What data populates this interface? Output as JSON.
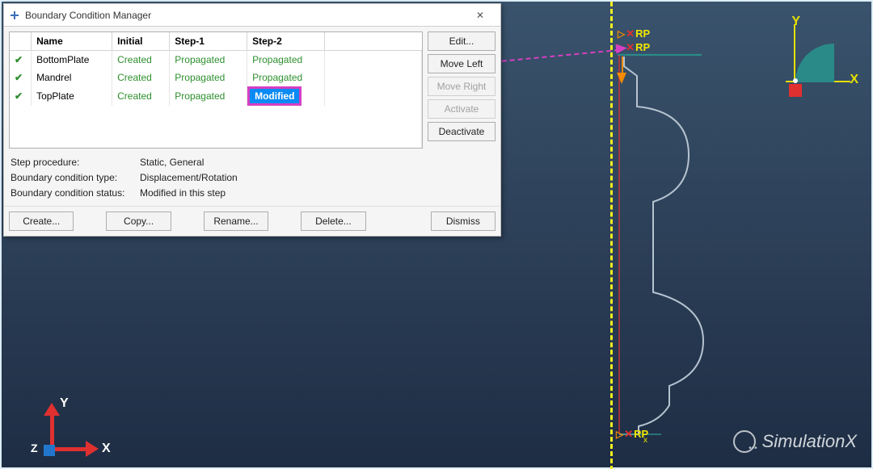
{
  "dialog": {
    "title": "Boundary Condition Manager",
    "close_glyph": "✕",
    "columns": [
      "Name",
      "Initial",
      "Step-1",
      "Step-2"
    ],
    "rows": [
      {
        "name": "BottomPlate",
        "initial": "Created",
        "step1": "Propagated",
        "step2": "Propagated",
        "step2_modified": false
      },
      {
        "name": "Mandrel",
        "initial": "Created",
        "step1": "Propagated",
        "step2": "Propagated",
        "step2_modified": false
      },
      {
        "name": "TopPlate",
        "initial": "Created",
        "step1": "Propagated",
        "step2": "Modified",
        "step2_modified": true
      }
    ],
    "side_buttons": {
      "edit": "Edit...",
      "move_left": "Move Left",
      "move_right": "Move Right",
      "activate": "Activate",
      "deactivate": "Deactivate"
    },
    "info": {
      "step_procedure_label": "Step procedure:",
      "step_procedure_value": "Static, General",
      "bc_type_label": "Boundary condition type:",
      "bc_type_value": "Displacement/Rotation",
      "bc_status_label": "Boundary condition status:",
      "bc_status_value": "Modified in this step"
    },
    "bottom_buttons": {
      "create": "Create...",
      "copy": "Copy...",
      "rename": "Rename...",
      "delete": "Delete...",
      "dismiss": "Dismiss"
    }
  },
  "triad_bl": {
    "x": "X",
    "y": "Y",
    "z": "Z"
  },
  "triad_tr": {
    "x": "X",
    "y": "Y"
  },
  "rp_labels": {
    "top1": "RP",
    "top2": "RP",
    "bottom": "RP"
  },
  "watermark": "SimulationX"
}
